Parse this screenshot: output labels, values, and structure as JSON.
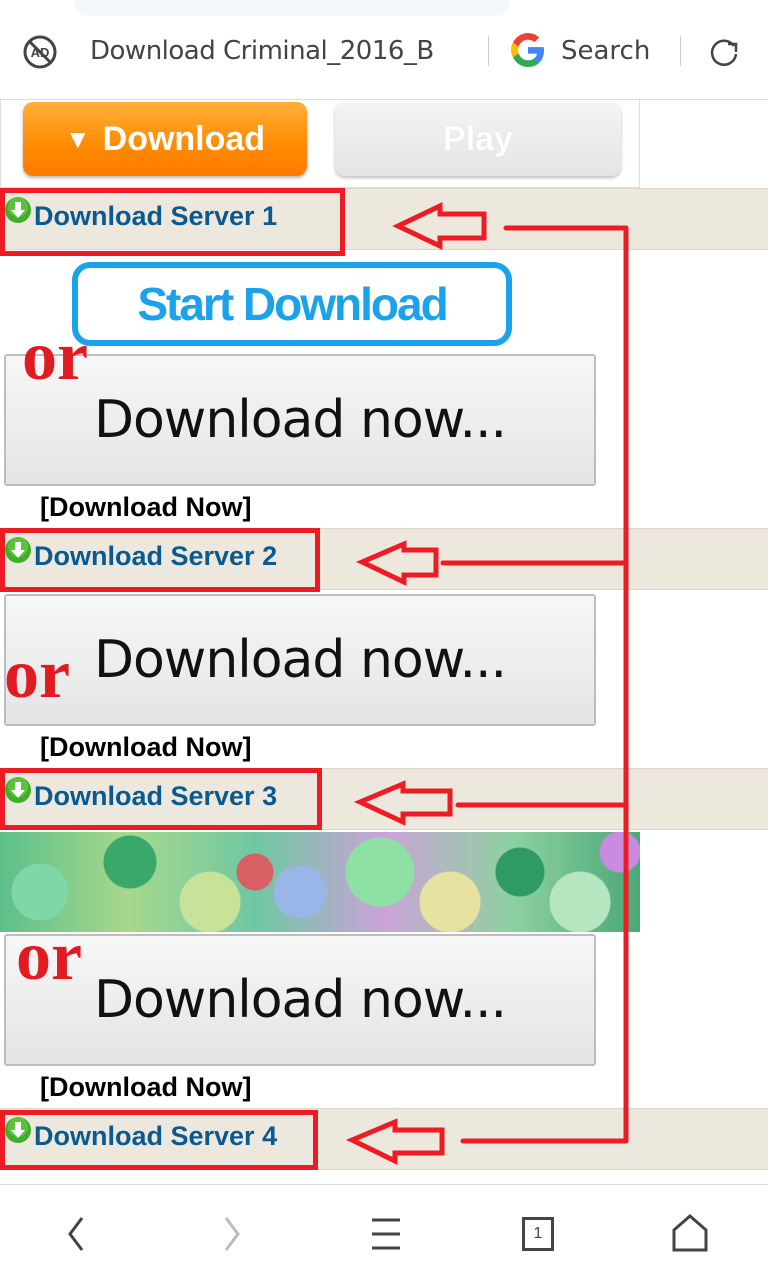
{
  "browser": {
    "page_title": "Download Criminal_2016_B",
    "search_label": "Search",
    "tab_count": "1",
    "icons": [
      "ad-block-icon",
      "google-icon",
      "reload-icon",
      "back-icon",
      "forward-icon",
      "menu-icon",
      "tabs-icon",
      "home-icon"
    ]
  },
  "top_buttons": {
    "download_label": "Download",
    "download_glyph": "▼",
    "play_label": "Play"
  },
  "servers": [
    {
      "label": "Download Server 1"
    },
    {
      "label": "Download Server 2"
    },
    {
      "label": "Download Server 3"
    },
    {
      "label": "Download Server 4"
    }
  ],
  "start_download_label": "Start Download",
  "download_now_button_label": "Download now...",
  "download_now_link_label": "[Download Now]",
  "or_label": "or",
  "colors": {
    "annotation_red": "#ed1c24",
    "server_link": "#0a5a8f",
    "download_orange": "#ff8a00",
    "start_download_blue": "#1aa3ea",
    "server_row_bg": "#ede8dd"
  }
}
